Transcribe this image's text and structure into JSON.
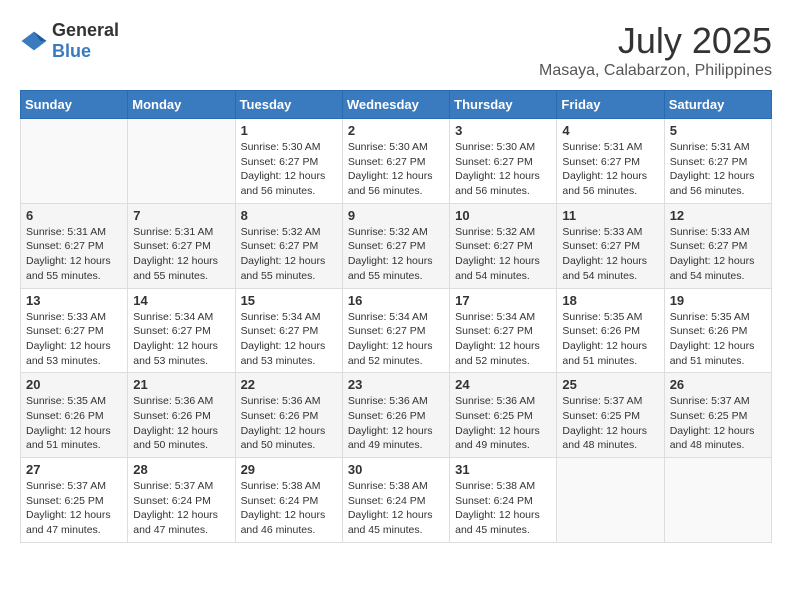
{
  "header": {
    "logo_general": "General",
    "logo_blue": "Blue",
    "month_year": "July 2025",
    "location": "Masaya, Calabarzon, Philippines"
  },
  "weekdays": [
    "Sunday",
    "Monday",
    "Tuesday",
    "Wednesday",
    "Thursday",
    "Friday",
    "Saturday"
  ],
  "weeks": [
    [
      {
        "day": "",
        "info": ""
      },
      {
        "day": "",
        "info": ""
      },
      {
        "day": "1",
        "info": "Sunrise: 5:30 AM\nSunset: 6:27 PM\nDaylight: 12 hours and 56 minutes."
      },
      {
        "day": "2",
        "info": "Sunrise: 5:30 AM\nSunset: 6:27 PM\nDaylight: 12 hours and 56 minutes."
      },
      {
        "day": "3",
        "info": "Sunrise: 5:30 AM\nSunset: 6:27 PM\nDaylight: 12 hours and 56 minutes."
      },
      {
        "day": "4",
        "info": "Sunrise: 5:31 AM\nSunset: 6:27 PM\nDaylight: 12 hours and 56 minutes."
      },
      {
        "day": "5",
        "info": "Sunrise: 5:31 AM\nSunset: 6:27 PM\nDaylight: 12 hours and 56 minutes."
      }
    ],
    [
      {
        "day": "6",
        "info": "Sunrise: 5:31 AM\nSunset: 6:27 PM\nDaylight: 12 hours and 55 minutes."
      },
      {
        "day": "7",
        "info": "Sunrise: 5:31 AM\nSunset: 6:27 PM\nDaylight: 12 hours and 55 minutes."
      },
      {
        "day": "8",
        "info": "Sunrise: 5:32 AM\nSunset: 6:27 PM\nDaylight: 12 hours and 55 minutes."
      },
      {
        "day": "9",
        "info": "Sunrise: 5:32 AM\nSunset: 6:27 PM\nDaylight: 12 hours and 55 minutes."
      },
      {
        "day": "10",
        "info": "Sunrise: 5:32 AM\nSunset: 6:27 PM\nDaylight: 12 hours and 54 minutes."
      },
      {
        "day": "11",
        "info": "Sunrise: 5:33 AM\nSunset: 6:27 PM\nDaylight: 12 hours and 54 minutes."
      },
      {
        "day": "12",
        "info": "Sunrise: 5:33 AM\nSunset: 6:27 PM\nDaylight: 12 hours and 54 minutes."
      }
    ],
    [
      {
        "day": "13",
        "info": "Sunrise: 5:33 AM\nSunset: 6:27 PM\nDaylight: 12 hours and 53 minutes."
      },
      {
        "day": "14",
        "info": "Sunrise: 5:34 AM\nSunset: 6:27 PM\nDaylight: 12 hours and 53 minutes."
      },
      {
        "day": "15",
        "info": "Sunrise: 5:34 AM\nSunset: 6:27 PM\nDaylight: 12 hours and 53 minutes."
      },
      {
        "day": "16",
        "info": "Sunrise: 5:34 AM\nSunset: 6:27 PM\nDaylight: 12 hours and 52 minutes."
      },
      {
        "day": "17",
        "info": "Sunrise: 5:34 AM\nSunset: 6:27 PM\nDaylight: 12 hours and 52 minutes."
      },
      {
        "day": "18",
        "info": "Sunrise: 5:35 AM\nSunset: 6:26 PM\nDaylight: 12 hours and 51 minutes."
      },
      {
        "day": "19",
        "info": "Sunrise: 5:35 AM\nSunset: 6:26 PM\nDaylight: 12 hours and 51 minutes."
      }
    ],
    [
      {
        "day": "20",
        "info": "Sunrise: 5:35 AM\nSunset: 6:26 PM\nDaylight: 12 hours and 51 minutes."
      },
      {
        "day": "21",
        "info": "Sunrise: 5:36 AM\nSunset: 6:26 PM\nDaylight: 12 hours and 50 minutes."
      },
      {
        "day": "22",
        "info": "Sunrise: 5:36 AM\nSunset: 6:26 PM\nDaylight: 12 hours and 50 minutes."
      },
      {
        "day": "23",
        "info": "Sunrise: 5:36 AM\nSunset: 6:26 PM\nDaylight: 12 hours and 49 minutes."
      },
      {
        "day": "24",
        "info": "Sunrise: 5:36 AM\nSunset: 6:25 PM\nDaylight: 12 hours and 49 minutes."
      },
      {
        "day": "25",
        "info": "Sunrise: 5:37 AM\nSunset: 6:25 PM\nDaylight: 12 hours and 48 minutes."
      },
      {
        "day": "26",
        "info": "Sunrise: 5:37 AM\nSunset: 6:25 PM\nDaylight: 12 hours and 48 minutes."
      }
    ],
    [
      {
        "day": "27",
        "info": "Sunrise: 5:37 AM\nSunset: 6:25 PM\nDaylight: 12 hours and 47 minutes."
      },
      {
        "day": "28",
        "info": "Sunrise: 5:37 AM\nSunset: 6:24 PM\nDaylight: 12 hours and 47 minutes."
      },
      {
        "day": "29",
        "info": "Sunrise: 5:38 AM\nSunset: 6:24 PM\nDaylight: 12 hours and 46 minutes."
      },
      {
        "day": "30",
        "info": "Sunrise: 5:38 AM\nSunset: 6:24 PM\nDaylight: 12 hours and 45 minutes."
      },
      {
        "day": "31",
        "info": "Sunrise: 5:38 AM\nSunset: 6:24 PM\nDaylight: 12 hours and 45 minutes."
      },
      {
        "day": "",
        "info": ""
      },
      {
        "day": "",
        "info": ""
      }
    ]
  ]
}
